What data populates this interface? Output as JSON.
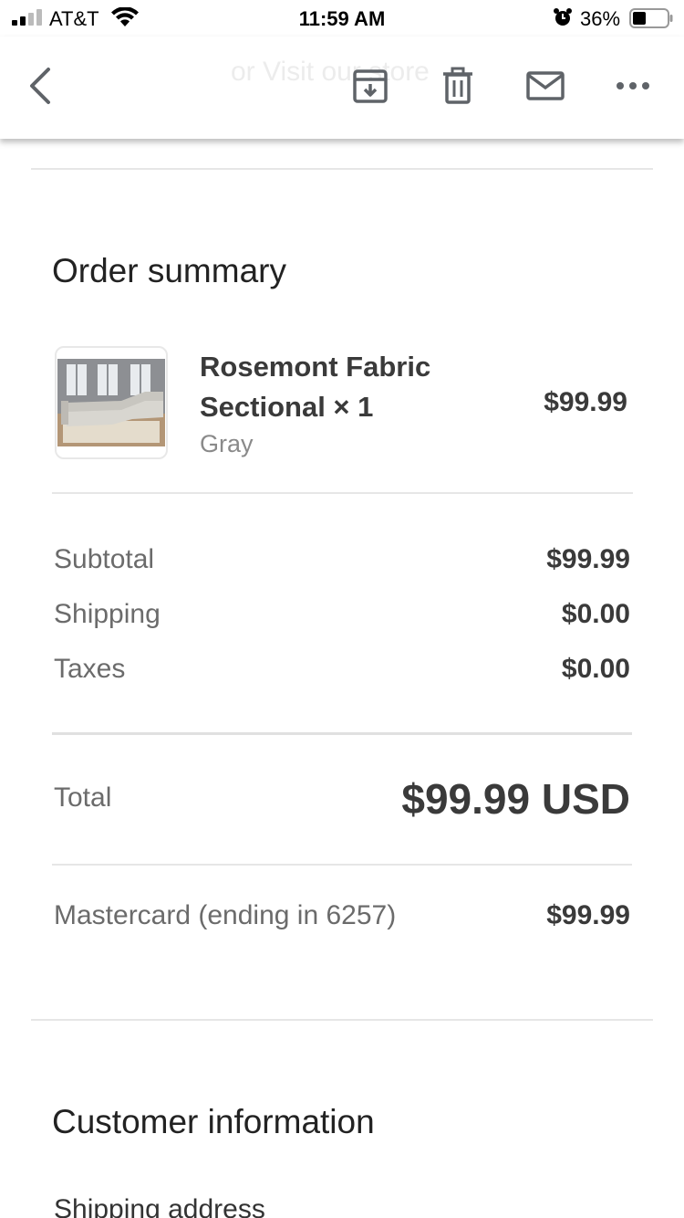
{
  "status_bar": {
    "carrier": "AT&T",
    "time": "11:59 AM",
    "battery_pct": "36%"
  },
  "toolbar": {
    "ghost_text": "or Visit our store",
    "icons": [
      "back-arrow-icon",
      "archive-icon",
      "trash-icon",
      "mail-icon",
      "more-icon"
    ]
  },
  "order_summary": {
    "title": "Order summary",
    "item": {
      "name": "Rosemont Fabric Sectional × 1",
      "variant": "Gray",
      "price": "$99.99"
    },
    "subtotal_label": "Subtotal",
    "subtotal_value": "$99.99",
    "shipping_label": "Shipping",
    "shipping_value": "$0.00",
    "taxes_label": "Taxes",
    "taxes_value": "$0.00",
    "total_label": "Total",
    "total_value": "$99.99 USD",
    "payment_label": "Mastercard (ending in 6257)",
    "payment_value": "$99.99"
  },
  "customer_information": {
    "title": "Customer information",
    "shipping_address_label": "Shipping address"
  },
  "colors": {
    "text_dark": "#3a3a3a",
    "text_muted": "#6b6b6b",
    "divider": "#e6e6e6"
  }
}
